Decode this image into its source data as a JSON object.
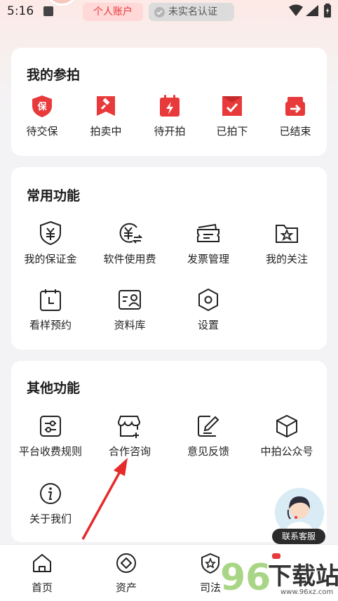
{
  "status_bar": {
    "time": "5:16"
  },
  "header": {
    "account_badge": "个人账户",
    "verify_badge": "未实名认证"
  },
  "participation": {
    "title": "我的参拍",
    "items": [
      {
        "label": "待交保",
        "icon": "deposit-shield-icon",
        "glyph": "保"
      },
      {
        "label": "拍卖中",
        "icon": "gavel-icon"
      },
      {
        "label": "待开拍",
        "icon": "calendar-bolt-icon"
      },
      {
        "label": "已拍下",
        "icon": "check-bag-icon"
      },
      {
        "label": "已结束",
        "icon": "box-exit-icon"
      }
    ]
  },
  "common": {
    "title": "常用功能",
    "items": [
      {
        "label": "我的保证金",
        "icon": "yuan-shield-icon"
      },
      {
        "label": "软件使用费",
        "icon": "yuan-exchange-icon"
      },
      {
        "label": "发票管理",
        "icon": "invoice-ticket-icon"
      },
      {
        "label": "我的关注",
        "icon": "star-folder-icon"
      },
      {
        "label": "看样预约",
        "icon": "calendar-clock-icon"
      },
      {
        "label": "资料库",
        "icon": "profile-card-icon"
      },
      {
        "label": "设置",
        "icon": "settings-icon"
      }
    ]
  },
  "other": {
    "title": "其他功能",
    "items": [
      {
        "label": "平台收费规则",
        "icon": "sliders-icon"
      },
      {
        "label": "合作咨询",
        "icon": "storefront-plus-icon"
      },
      {
        "label": "意见反馈",
        "icon": "edit-note-icon"
      },
      {
        "label": "中拍公众号",
        "icon": "cube-icon"
      },
      {
        "label": "关于我们",
        "icon": "info-icon"
      }
    ]
  },
  "service": {
    "label": "联系客服"
  },
  "bottom_nav": [
    {
      "label": "首页",
      "icon": "home-icon"
    },
    {
      "label": "资产",
      "icon": "asset-diamond-icon"
    },
    {
      "label": "司法",
      "icon": "judicial-star-icon"
    }
  ],
  "watermark": {
    "text": "下载站",
    "number": "96",
    "url": "www.96xz.com"
  },
  "colors": {
    "accent": "#e8393b",
    "card": "#ffffff",
    "background": "#f3f3f5"
  }
}
